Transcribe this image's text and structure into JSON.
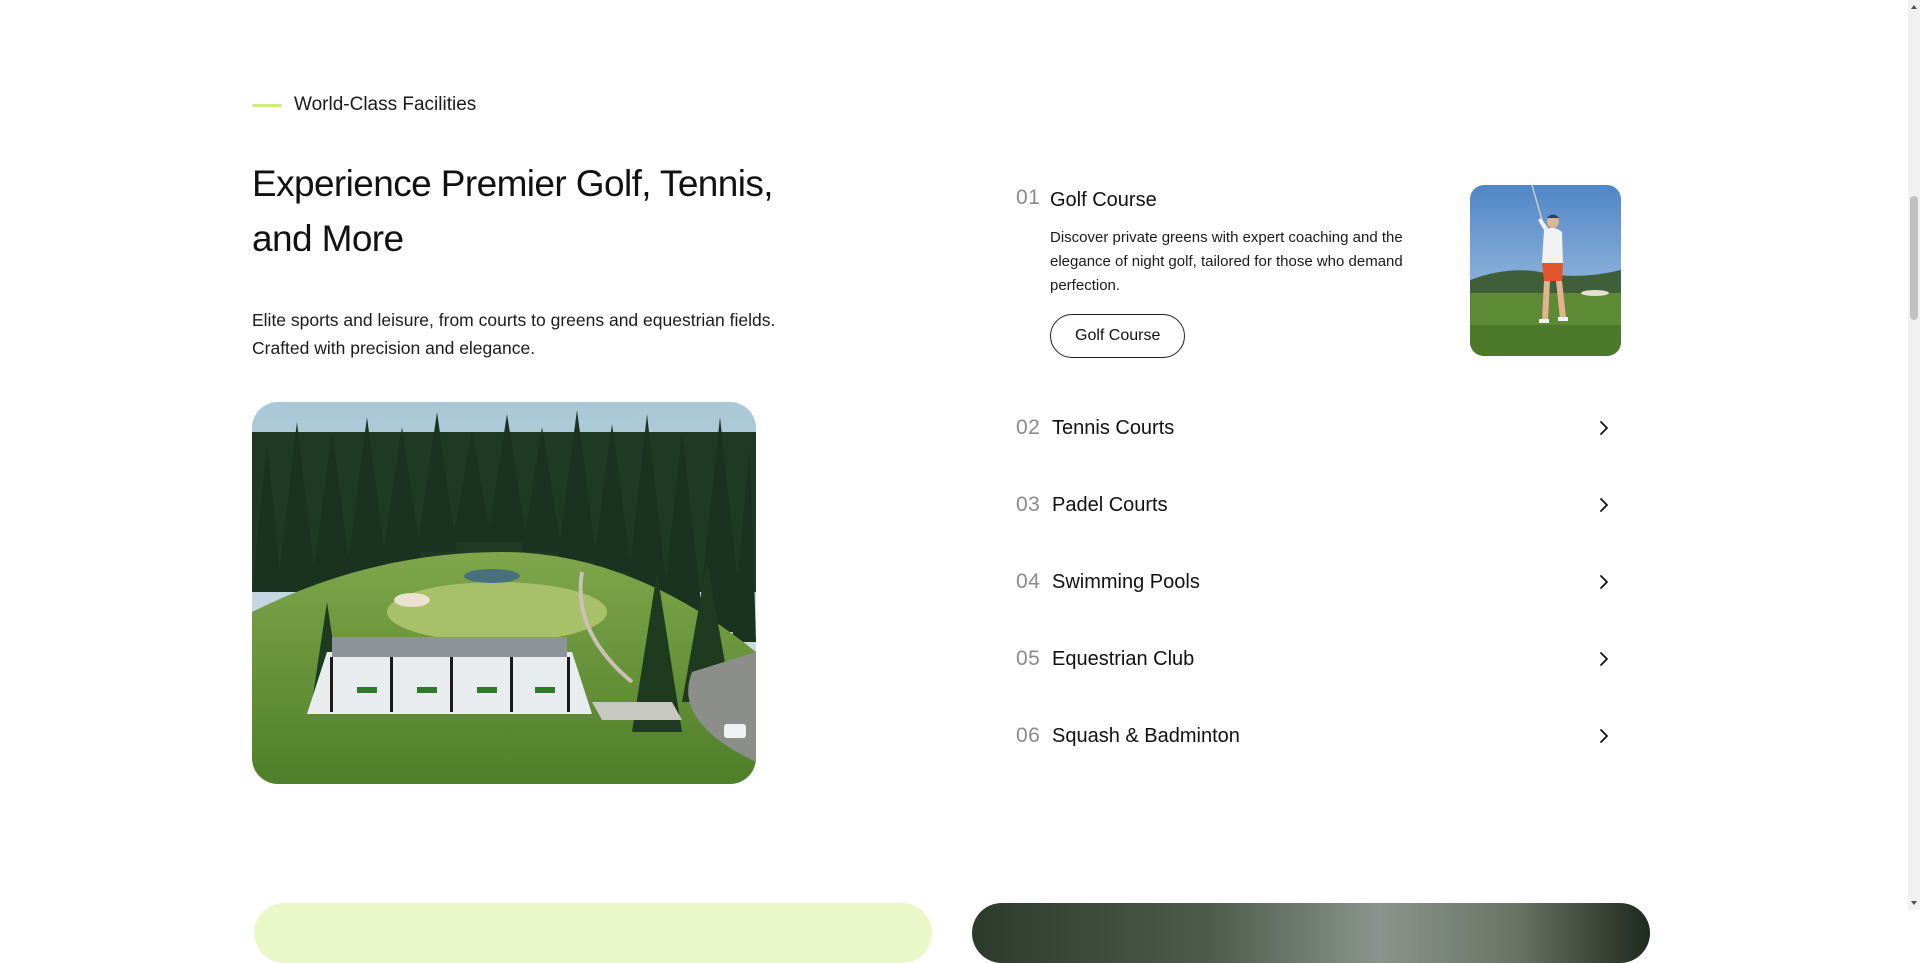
{
  "section": {
    "eyebrow": "World-Class Facilities",
    "title": "Experience Premier Golf, Tennis, and More",
    "intro": "Elite sports and leisure, from courts to greens and equestrian fields. Crafted with precision and elegance.",
    "accent_color": "#cfe88a"
  },
  "facilities": {
    "open": {
      "number": "01",
      "title": "Golf Course",
      "description": "Discover private greens with expert coaching and the elegance of night golf, tailored for those who demand perfection.",
      "button_label": "Golf Course"
    },
    "items": [
      {
        "number": "02",
        "title": "Tennis Courts"
      },
      {
        "number": "03",
        "title": "Padel Courts"
      },
      {
        "number": "04",
        "title": "Swimming Pools"
      },
      {
        "number": "05",
        "title": "Equestrian Club"
      },
      {
        "number": "06",
        "title": "Squash & Badminton"
      }
    ]
  },
  "icons": {
    "row_arrow": "chevron-right-icon"
  }
}
